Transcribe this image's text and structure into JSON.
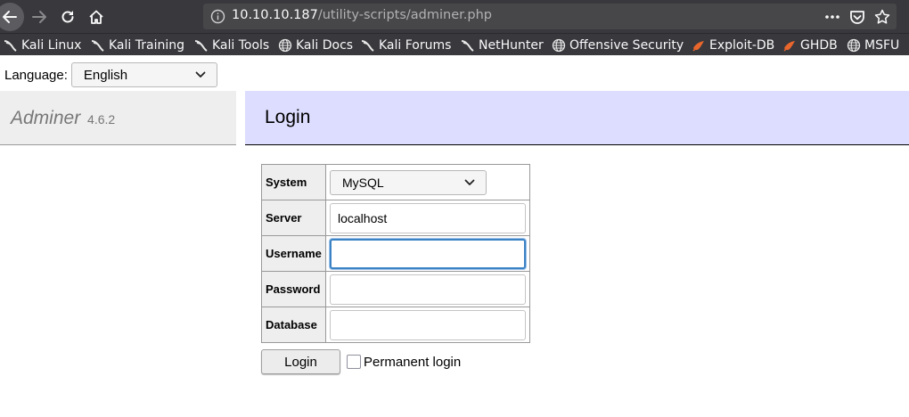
{
  "browser": {
    "url_host": "10.10.10.187",
    "url_path": "/utility-scripts/adminer.php",
    "bookmarks": [
      {
        "label": "Kali Linux",
        "icon": "kali-dragon-icon"
      },
      {
        "label": "Kali Training",
        "icon": "kali-dragon-icon"
      },
      {
        "label": "Kali Tools",
        "icon": "kali-dragon-icon"
      },
      {
        "label": "Kali Docs",
        "icon": "globe-icon"
      },
      {
        "label": "Kali Forums",
        "icon": "kali-dragon-icon"
      },
      {
        "label": "NetHunter",
        "icon": "kali-dragon-icon"
      },
      {
        "label": "Offensive Security",
        "icon": "globe-icon"
      },
      {
        "label": "Exploit-DB",
        "icon": "exploit-db-icon"
      },
      {
        "label": "GHDB",
        "icon": "exploit-db-icon"
      },
      {
        "label": "MSFU",
        "icon": "globe-icon"
      }
    ]
  },
  "language": {
    "label": "Language:",
    "selected": "English"
  },
  "menu": {
    "app_name": "Adminer",
    "version": "4.6.2"
  },
  "content": {
    "title": "Login"
  },
  "form": {
    "system_label": "System",
    "system_value": "MySQL",
    "server_label": "Server",
    "server_value": "localhost",
    "username_label": "Username",
    "username_value": "",
    "password_label": "Password",
    "password_value": "",
    "database_label": "Database",
    "database_value": "",
    "submit_label": "Login",
    "permanent_label": "Permanent login"
  }
}
